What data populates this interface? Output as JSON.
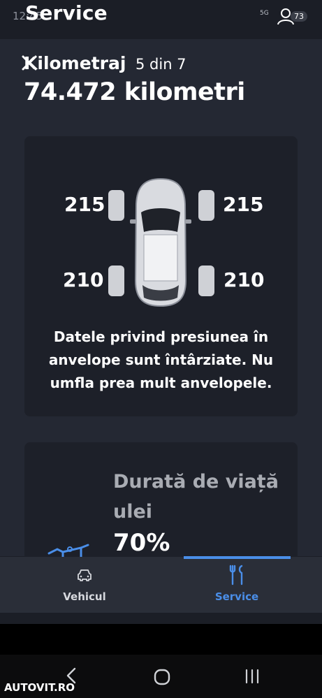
{
  "statusbar": {
    "time": "12:45",
    "network": "5G",
    "badge": "73"
  },
  "header": {
    "title": "Service"
  },
  "overlay": {
    "title": "Kilometraj",
    "counter": "5 din 7",
    "distance": "74.472 kilometri"
  },
  "tires": {
    "front_left": "215",
    "front_right": "215",
    "rear_left": "210",
    "rear_right": "210",
    "message": "Datele privind presiunea în anvelope sunt întârziate. Nu umfla prea mult anvelopele."
  },
  "oil": {
    "title": "Durată de viață ulei",
    "percent": "70%"
  },
  "bottom_nav": {
    "items": [
      {
        "label": "Vehicul",
        "icon": "car-icon",
        "active": false
      },
      {
        "label": "Service",
        "icon": "tools-icon",
        "active": true
      }
    ],
    "accent": "#4a8ee8"
  },
  "watermark": "AUTOVIT.RO",
  "colors": {
    "background": "#1b1e26",
    "panel": "#242833",
    "card": "#1d2029",
    "accent": "#4a8ee8"
  }
}
